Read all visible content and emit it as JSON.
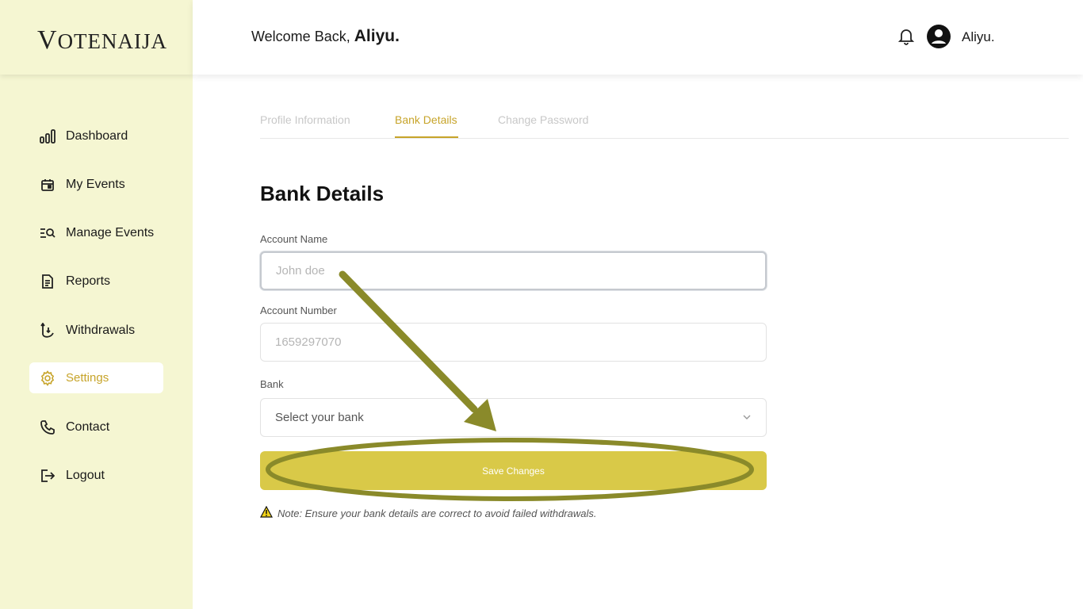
{
  "brand": {
    "logo_first": "V",
    "logo_rest": "OTENAIJA",
    "accent_color": "#c7a42a",
    "sidebar_color": "#f5f6d2",
    "button_color": "#d9c948"
  },
  "header": {
    "welcome_prefix": "Welcome Back,",
    "welcome_name": "Aliyu.",
    "user_name": "Aliyu."
  },
  "sidebar": {
    "items": [
      {
        "label": "Dashboard",
        "icon": "bar-chart-icon"
      },
      {
        "label": "My Events",
        "icon": "calendar-icon"
      },
      {
        "label": "Manage Events",
        "icon": "list-search-icon"
      },
      {
        "label": "Reports",
        "icon": "document-icon"
      },
      {
        "label": "Withdrawals",
        "icon": "withdraw-icon"
      },
      {
        "label": "Settings",
        "icon": "gear-icon",
        "active": true
      },
      {
        "label": "Contact",
        "icon": "phone-icon"
      },
      {
        "label": "Logout",
        "icon": "logout-icon"
      }
    ]
  },
  "tabs": [
    {
      "label": "Profile Information"
    },
    {
      "label": "Bank Details",
      "active": true
    },
    {
      "label": "Change Password"
    }
  ],
  "form": {
    "title": "Bank Details",
    "account_name": {
      "label": "Account Name",
      "placeholder": "John doe",
      "value": ""
    },
    "account_number": {
      "label": "Account Number",
      "placeholder": "1659297070",
      "value": ""
    },
    "bank": {
      "label": "Bank",
      "selected": "Select your bank"
    },
    "save_label": "Save Changes",
    "note": "Note: Ensure your bank details are correct to avoid failed withdrawals."
  }
}
